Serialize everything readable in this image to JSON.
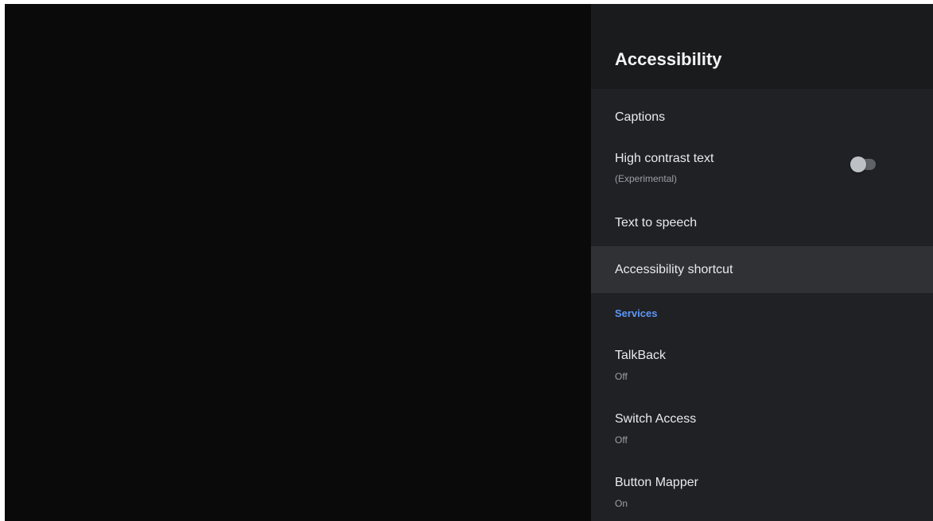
{
  "panel": {
    "title": "Accessibility"
  },
  "items": {
    "captions": {
      "label": "Captions"
    },
    "high_contrast": {
      "label": "High contrast text",
      "sub": "(Experimental)",
      "toggle_state": "off"
    },
    "tts": {
      "label": "Text to speech"
    },
    "shortcut": {
      "label": "Accessibility shortcut"
    }
  },
  "services": {
    "header": "Services",
    "talkback": {
      "label": "TalkBack",
      "status": "Off"
    },
    "switch_access": {
      "label": "Switch Access",
      "status": "Off"
    },
    "button_mapper": {
      "label": "Button Mapper",
      "status": "On"
    }
  },
  "colors": {
    "panel_bg": "#202124",
    "header_bg": "#1a1b1d",
    "focus_bg": "#303134",
    "accent": "#5e97f6",
    "backdrop": "#0a0a0a"
  }
}
